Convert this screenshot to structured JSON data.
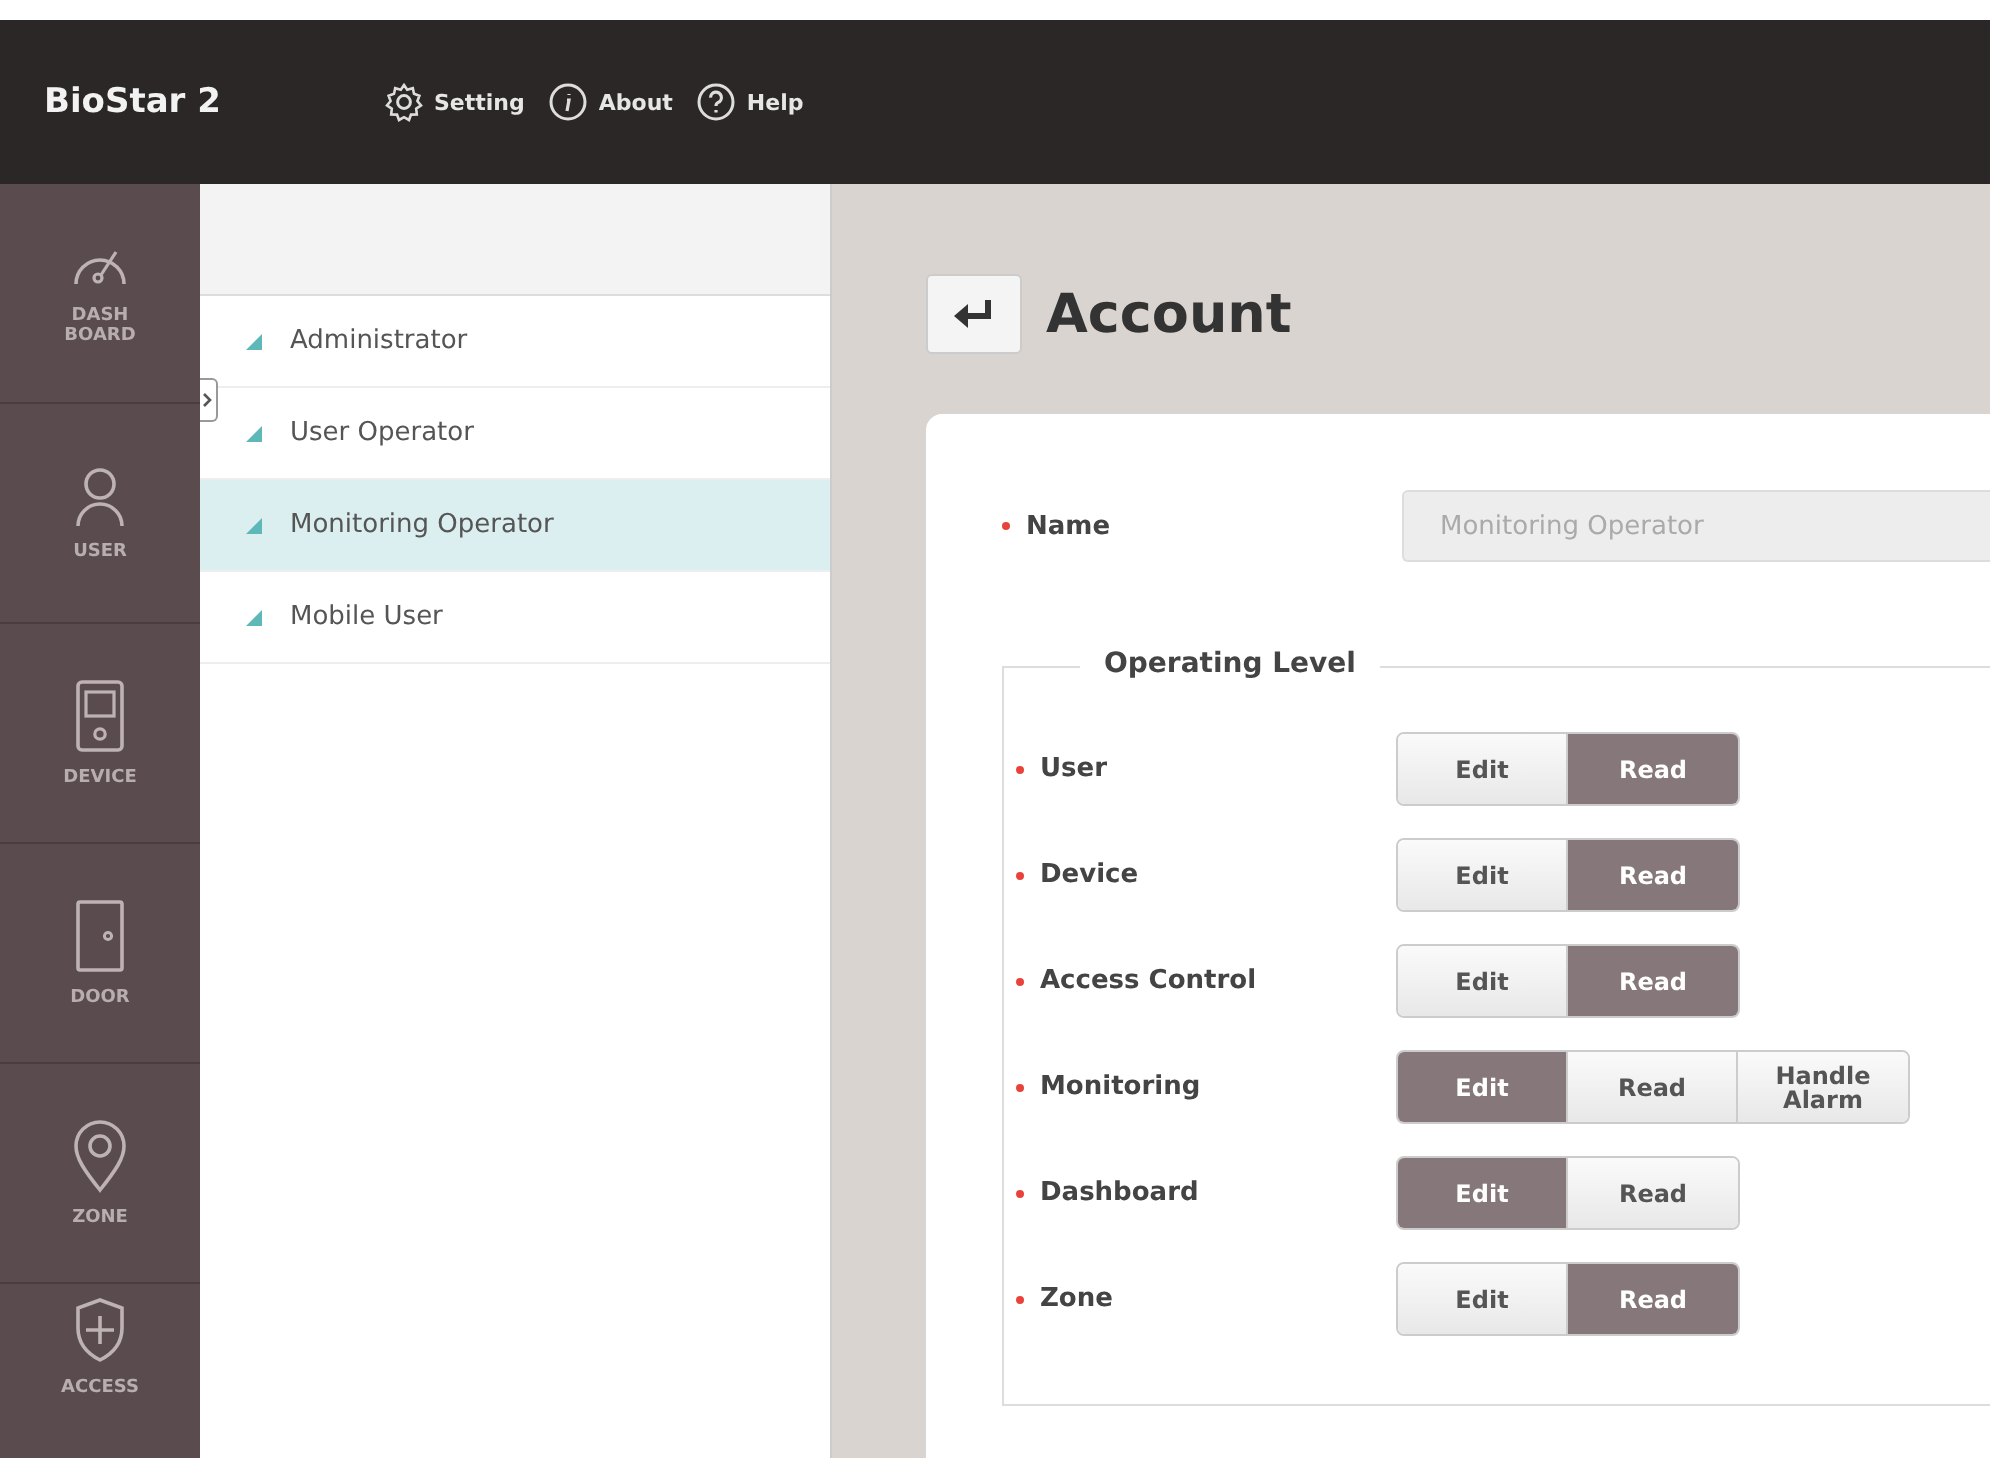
{
  "header": {
    "logo": "BioStar 2",
    "menu": [
      {
        "kind": "gear",
        "label": "Setting"
      },
      {
        "kind": "info",
        "label": "About"
      },
      {
        "kind": "help",
        "label": "Help"
      }
    ]
  },
  "nav": [
    {
      "kind": "gauge",
      "label": "DASH BOARD"
    },
    {
      "kind": "user",
      "label": "USER"
    },
    {
      "kind": "device",
      "label": "DEVICE"
    },
    {
      "kind": "door",
      "label": "DOOR"
    },
    {
      "kind": "pin",
      "label": "ZONE"
    },
    {
      "kind": "shield",
      "label": "ACCESS"
    }
  ],
  "accounts": [
    {
      "label": "Administrator",
      "selected": false
    },
    {
      "label": "User Operator",
      "selected": false
    },
    {
      "label": "Monitoring Operator",
      "selected": true
    },
    {
      "label": "Mobile User",
      "selected": false
    }
  ],
  "page": {
    "title": "Account",
    "name_label": "Name",
    "name_value": "Monitoring Operator",
    "name_disabled": true,
    "section": "Operating Level",
    "levels": [
      {
        "label": "User",
        "options": [
          {
            "label": "Edit",
            "selected": false
          },
          {
            "label": "Read",
            "selected": true
          }
        ]
      },
      {
        "label": "Device",
        "options": [
          {
            "label": "Edit",
            "selected": false
          },
          {
            "label": "Read",
            "selected": true
          }
        ]
      },
      {
        "label": "Access Control",
        "options": [
          {
            "label": "Edit",
            "selected": false
          },
          {
            "label": "Read",
            "selected": true
          }
        ]
      },
      {
        "label": "Monitoring",
        "options": [
          {
            "label": "Edit",
            "selected": true
          },
          {
            "label": "Read",
            "selected": false
          },
          {
            "label": "Handle Alarm",
            "selected": false
          }
        ]
      },
      {
        "label": "Dashboard",
        "options": [
          {
            "label": "Edit",
            "selected": true
          },
          {
            "label": "Read",
            "selected": false
          }
        ]
      },
      {
        "label": "Zone",
        "options": [
          {
            "label": "Edit",
            "selected": false
          },
          {
            "label": "Read",
            "selected": true
          }
        ]
      }
    ]
  }
}
